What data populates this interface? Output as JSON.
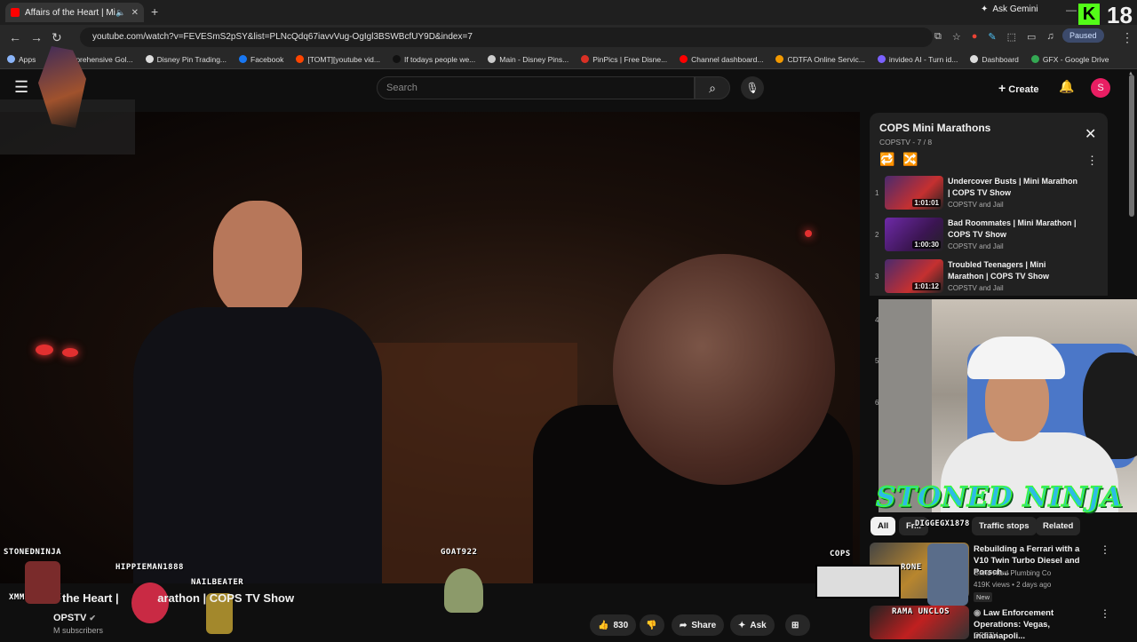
{
  "browser": {
    "tab_title": "Affairs of the Heart | Mini Marathon",
    "new_tab": "+",
    "gemini": "Ask Gemini",
    "badge_k": "K",
    "badge_18": "18",
    "url": "youtube.com/watch?v=FEVESmS2pSY&list=PLNcQdq67iavvVug-OgIgl3BSWBcfUY9D&index=7",
    "paused": "Paused",
    "bookmarks": [
      {
        "label": "Apps",
        "color": "#8ab4f8"
      },
      {
        "label": "Comprehensive Gol...",
        "color": "#aaaaaa"
      },
      {
        "label": "Disney Pin Trading...",
        "color": "#dddddd"
      },
      {
        "label": "Facebook",
        "color": "#1877f2"
      },
      {
        "label": "[TOMT][youtube vid...",
        "color": "#ff4500"
      },
      {
        "label": "If todays people we...",
        "color": "#111111"
      },
      {
        "label": "Main - Disney Pins...",
        "color": "#cccccc"
      },
      {
        "label": "PinPics | Free Disne...",
        "color": "#d93025"
      },
      {
        "label": "Channel dashboard...",
        "color": "#ff0000"
      },
      {
        "label": "CDTFA Online Servic...",
        "color": "#f29900"
      },
      {
        "label": "invideo AI - Turn id...",
        "color": "#7b61ff"
      },
      {
        "label": "Dashboard",
        "color": "#dddddd"
      },
      {
        "label": "GFX - Google Drive",
        "color": "#34a853"
      }
    ]
  },
  "masthead": {
    "search_placeholder": "Search",
    "create_label": "Create",
    "avatar_letter": "S"
  },
  "overlay": {
    "usernames": {
      "stonedninja": "STONEDNINJA",
      "hippieman": "HIPPIEMAN1888",
      "nailbeater": "NAILBEATER",
      "goat": "GOAT922",
      "xmma": "XMMAMOTOXX",
      "cops": "COPS"
    },
    "ninja_text": "STONED NINJA"
  },
  "video_info": {
    "title_fragment_1": "the Heart | ",
    "title_fragment_2": "arathon | COPS TV Show",
    "channel": "OPSTV",
    "subscribers": "M subscribers",
    "like_count": "830",
    "share": "Share",
    "ask": "Ask"
  },
  "playlist": {
    "title": "COPS Mini Marathons",
    "subtitle": "COPSTV - 7 / 8",
    "items": [
      {
        "index": "1",
        "title": "Undercover Busts | Mini Marathon | COPS TV Show",
        "channel": "COPSTV and Jail",
        "duration": "1:01:01"
      },
      {
        "index": "2",
        "title": "Bad Roommates | Mini Marathon | COPS TV Show",
        "channel": "COPSTV and Jail",
        "duration": "1:00:30"
      },
      {
        "index": "3",
        "title": "Troubled Teenagers | Mini Marathon | COPS TV Show",
        "channel": "COPSTV and Jail",
        "duration": "1:01:12"
      }
    ],
    "hidden_indexes": [
      "4",
      "5",
      "6"
    ]
  },
  "chips": [
    "All",
    "Fr...",
    "Traffic stops",
    "Related"
  ],
  "chip_overlay_text": "DIGGEGX1878",
  "recommendations": [
    {
      "title": "Rebuilding a Ferrari with a V10 Twin Turbo Diesel and Porsch...",
      "channel": "Grind Hard Plumbing Co",
      "meta": "419K views • 2 days ago",
      "badge": "New",
      "thumb_text": "RONE"
    },
    {
      "title": "Law Enforcement Operations: Vegas, Indianapoli...",
      "channel": "OPSTV",
      "meta": "",
      "thumb_text": "RAMA UNCLOS"
    }
  ],
  "colors": {
    "accent": "#ff0000",
    "ninja_fill": "#2dbbe6",
    "ninja_stroke": "#3cff2a",
    "kick_green": "#53fc18"
  }
}
